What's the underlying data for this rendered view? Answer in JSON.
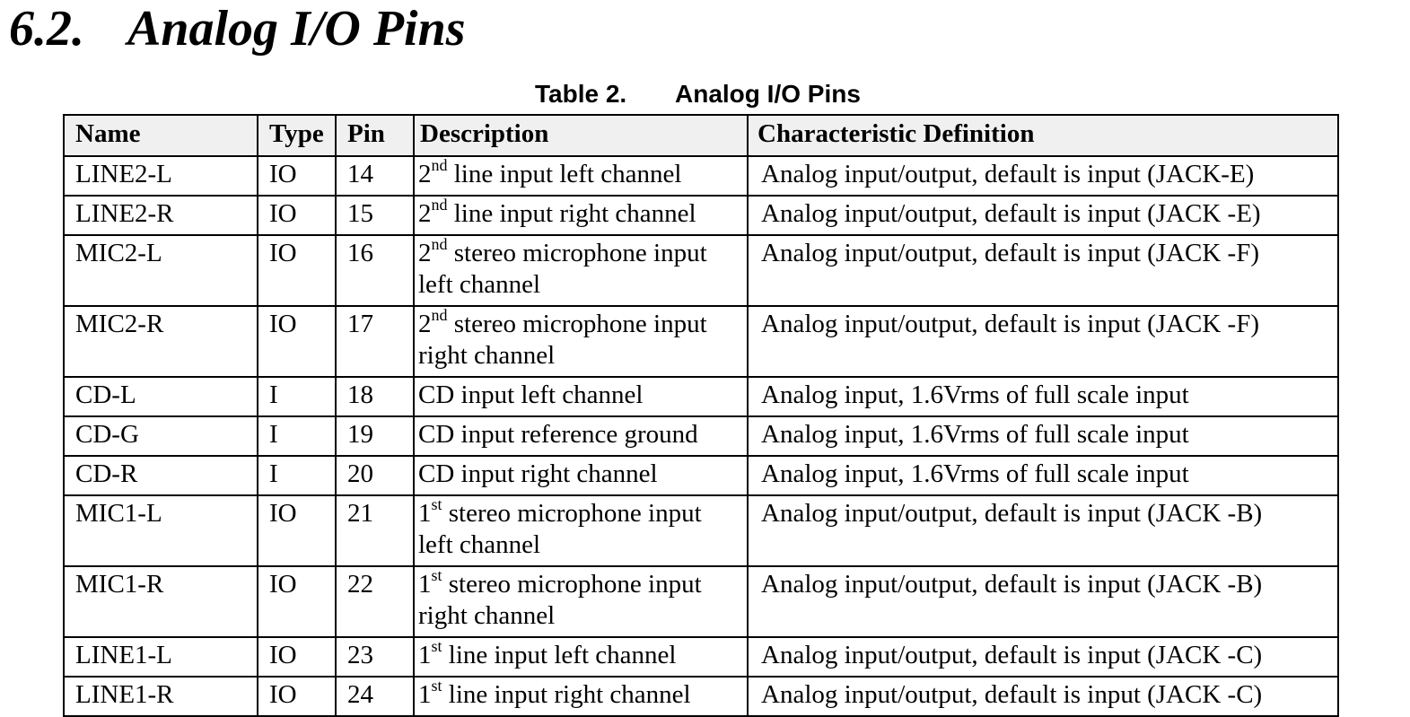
{
  "section": {
    "number": "6.2.",
    "title": "Analog I/O Pins"
  },
  "caption": {
    "number": "Table 2.",
    "title": "Analog I/O Pins"
  },
  "table": {
    "headers": [
      "Name",
      "Type",
      "Pin",
      "Description",
      "Characteristic Definition"
    ],
    "rows": [
      {
        "name": "LINE2-L",
        "type": "IO",
        "pin": "14",
        "desc_ordinal": "2",
        "desc_sup": "nd",
        "desc_text": " line input left channel",
        "definition": "Analog input/output, default is input (JACK-E)"
      },
      {
        "name": "LINE2-R",
        "type": "IO",
        "pin": "15",
        "desc_ordinal": "2",
        "desc_sup": "nd",
        "desc_text": " line input right channel",
        "definition": "Analog input/output, default is input (JACK -E)"
      },
      {
        "name": "MIC2-L",
        "type": "IO",
        "pin": "16",
        "desc_ordinal": "2",
        "desc_sup": "nd",
        "desc_text": " stereo microphone input left channel",
        "definition": "Analog input/output, default is input (JACK -F)"
      },
      {
        "name": "MIC2-R",
        "type": "IO",
        "pin": "17",
        "desc_ordinal": "2",
        "desc_sup": "nd",
        "desc_text": " stereo microphone input right channel",
        "definition": "Analog input/output, default is input (JACK -F)"
      },
      {
        "name": "CD-L",
        "type": "I",
        "pin": "18",
        "desc_ordinal": "",
        "desc_sup": "",
        "desc_text": "CD input left channel",
        "definition": "Analog input, 1.6Vrms of full scale input"
      },
      {
        "name": "CD-G",
        "type": "I",
        "pin": "19",
        "desc_ordinal": "",
        "desc_sup": "",
        "desc_text": "CD input reference ground",
        "definition": "Analog input, 1.6Vrms of full scale input"
      },
      {
        "name": "CD-R",
        "type": "I",
        "pin": "20",
        "desc_ordinal": "",
        "desc_sup": "",
        "desc_text": "CD input right channel",
        "definition": "Analog input, 1.6Vrms of full scale input"
      },
      {
        "name": "MIC1-L",
        "type": "IO",
        "pin": "21",
        "desc_ordinal": "1",
        "desc_sup": "st",
        "desc_text": " stereo microphone input left channel",
        "definition": "Analog input/output, default is input (JACK -B)"
      },
      {
        "name": "MIC1-R",
        "type": "IO",
        "pin": "22",
        "desc_ordinal": "1",
        "desc_sup": "st",
        "desc_text": " stereo microphone input right channel",
        "definition": "Analog input/output, default is input (JACK -B)"
      },
      {
        "name": "LINE1-L",
        "type": "IO",
        "pin": "23",
        "desc_ordinal": "1",
        "desc_sup": "st",
        "desc_text": " line input left channel",
        "definition": "Analog input/output, default is input (JACK -C)"
      },
      {
        "name": "LINE1-R",
        "type": "IO",
        "pin": "24",
        "desc_ordinal": "1",
        "desc_sup": "st",
        "desc_text": " line input right channel",
        "definition": "Analog input/output, default is input (JACK -C)"
      }
    ]
  }
}
